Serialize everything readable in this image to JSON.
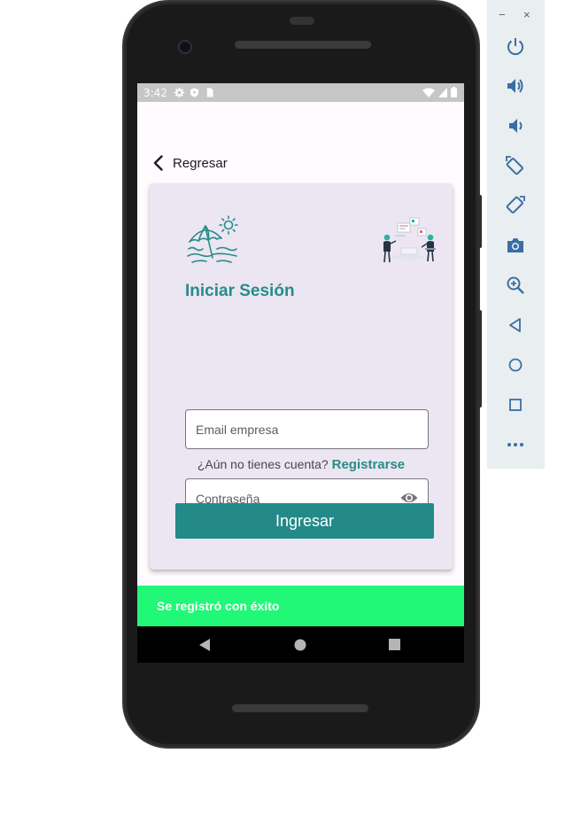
{
  "status_bar": {
    "time": "3:42"
  },
  "header": {
    "back_label": "Regresar"
  },
  "login": {
    "title": "Iniciar Sesión",
    "email_placeholder": "Email empresa",
    "password_placeholder": "Contraseña",
    "signup_prompt": "¿Aún no tienes cuenta?",
    "signup_link": "Registrarse",
    "submit_label": "Ingresar"
  },
  "snackbar": {
    "message": "Se registró con éxito"
  },
  "colors": {
    "accent": "#288b8a",
    "button": "#238a89",
    "snackbar": "#21f878",
    "card": "#ebe6f1"
  },
  "emulator": {
    "window_controls": [
      "−",
      "×"
    ],
    "buttons": [
      "power-icon",
      "volume-up-icon",
      "volume-down-icon",
      "rotate-left-icon",
      "rotate-right-icon",
      "camera-icon",
      "zoom-icon",
      "back-icon",
      "home-icon",
      "overview-icon",
      "more-icon"
    ]
  }
}
